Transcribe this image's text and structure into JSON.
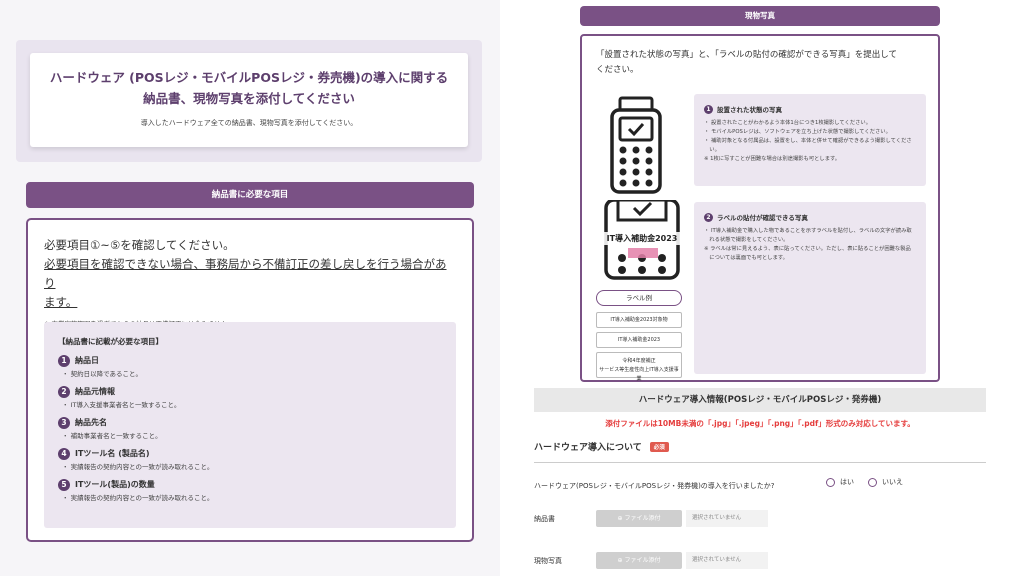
{
  "left": {
    "intro": {
      "title_line1": "ハードウェア (POSレジ・モバイルPOSレジ・券売機)の導入に関する",
      "title_line2": "納品書、現物写真を添付してください",
      "subtitle": "導入したハードウェア全ての納品書、現物写真を添付してください。"
    },
    "section_bar": "納品書に必要な項目",
    "requirements": {
      "heading": "必要項目①~⑤を確認してください。",
      "warning_line1": "必要項目を確認できない場合、事務局から不備訂正の差し戻しを行う場合があり",
      "warning_line2": "ます。",
      "note": "※ 事業実施期間を過ぎてからの納品は不備訂正には含みません。",
      "items_heading": "【納品書に記載が必要な項目】",
      "items": [
        {
          "num": "1",
          "title": "納品日",
          "desc": "・ 契約日以降であること。"
        },
        {
          "num": "2",
          "title": "納品元情報",
          "desc": "・ IT導入支援事業者名と一致すること。"
        },
        {
          "num": "3",
          "title": "納品先名",
          "desc": "・ 補助事業者名と一致すること。"
        },
        {
          "num": "4",
          "title": "ITツール名 (製品名)",
          "desc": "・ 実績報告の契約内容との一致が読み取れること。"
        },
        {
          "num": "5",
          "title": "ITツール(製品)の数量",
          "desc": "・ 実績報告の契約内容との一致が読み取れること。"
        }
      ]
    }
  },
  "right": {
    "photo_bar": "現物写真",
    "photo": {
      "heading_line1": "「設置された状態の写真」と、「ラベルの貼付の確認ができる写真」を提出して",
      "heading_line2": "ください。",
      "device_label": "IT導入補助金2023",
      "label_example": "ラベル例",
      "chips": [
        "IT導入補助金2023対象物",
        "IT導入補助金2023"
      ],
      "chip3_line1": "令和4年度補正",
      "chip3_line2": "サービス等生産性向上IT導入支援事業",
      "card1": {
        "num": "1",
        "title": "設置された状態の写真",
        "lines": [
          "・ 設置されたことがわかるよう本体1台につき1枚撮影してください。",
          "・ モバイルPOSレジは、ソフトウェアを立ち上げた状態で撮影してください。",
          "・ 補助対象となる付属品は、設置をし、本体と併せて確認ができるよう撮影してくださ",
          "　い。",
          "※ 1枚に写すことが困難な場合は別途撮影も可とします。"
        ]
      },
      "card2": {
        "num": "2",
        "title": "ラベルの貼付が確認できる写真",
        "lines": [
          "・ IT導入補助金で購入した物であることを示すラベルを貼付し、ラベルの文字が読み取",
          "　れる状態で撮影をしてください。",
          "※ ラベルは常に見えるよう、表に貼ってください。ただし、表に貼ることが困難な製品",
          "　については裏面でも可とします。"
        ]
      }
    },
    "hw_bar": "ハードウェア導入情報(POSレジ・モバイルPOSレジ・発券機)",
    "attach_note": "添付ファイルは10MB未満の「.jpg」「.jpeg」「.png」「.pdf」形式のみ対応しています。",
    "about_title": "ハードウェア導入について",
    "required_badge": "必須",
    "question": "ハードウェア(POSレジ・モバイルPOSレジ・発券機)の導入を行いましたか?",
    "radio_yes": "はい",
    "radio_no": "いいえ",
    "file_rows": [
      {
        "label": "納品書",
        "button": "ファイル添付",
        "status": "選択されていません"
      },
      {
        "label": "現物写真",
        "button": "ファイル添付",
        "status": "選択されていません"
      }
    ]
  }
}
